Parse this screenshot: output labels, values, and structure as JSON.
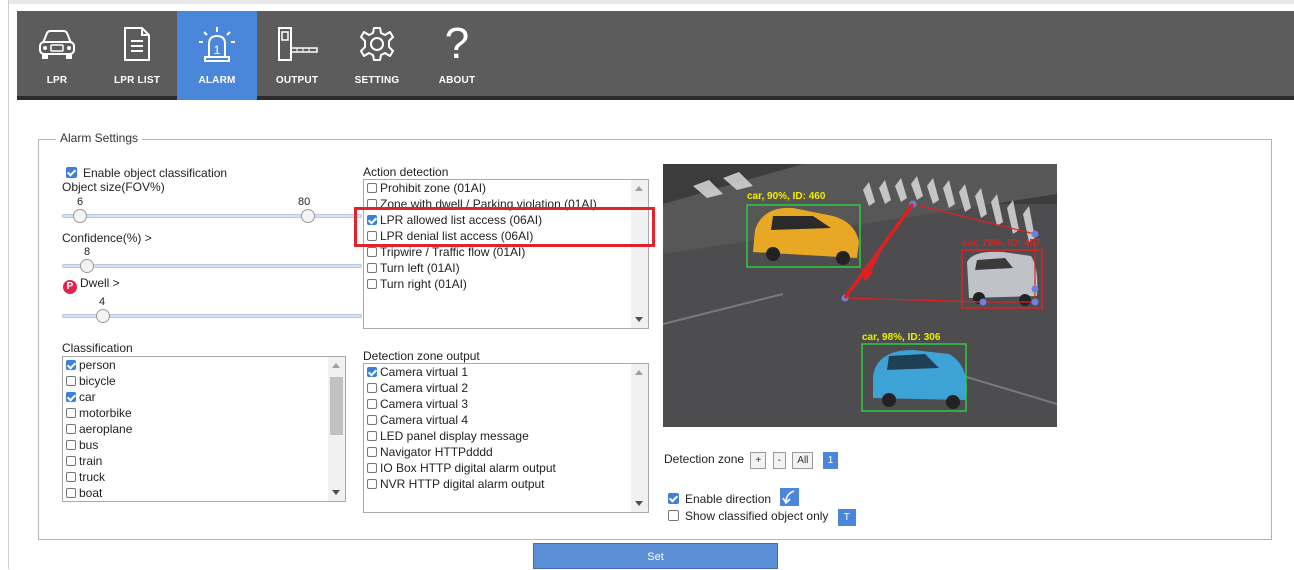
{
  "nav": [
    {
      "label": "LPR",
      "icon": "car-icon",
      "active": false
    },
    {
      "label": "LPR LIST",
      "icon": "document-icon",
      "active": false
    },
    {
      "label": "ALARM",
      "icon": "alarm-siren-icon",
      "active": true
    },
    {
      "label": "OUTPUT",
      "icon": "gate-barrier-icon",
      "active": false
    },
    {
      "label": "SETTING",
      "icon": "gear-icon",
      "active": false
    },
    {
      "label": "ABOUT",
      "icon": "question-icon",
      "active": false
    }
  ],
  "alarm": {
    "legend": "Alarm Settings",
    "enable_classification_label": "Enable object classification",
    "enable_classification_checked": true,
    "object_size_label": "Object size(FOV%)",
    "object_size_min_value": "6",
    "object_size_max_value": "80",
    "confidence_label": "Confidence(%) >",
    "confidence_value": "8",
    "dwell_label": "Dwell >",
    "dwell_value": "4",
    "dwell_icon": "parking-icon",
    "classification_label": "Classification",
    "classification_items": [
      {
        "label": "person",
        "checked": true
      },
      {
        "label": "bicycle",
        "checked": false
      },
      {
        "label": "car",
        "checked": true
      },
      {
        "label": "motorbike",
        "checked": false
      },
      {
        "label": "aeroplane",
        "checked": false
      },
      {
        "label": "bus",
        "checked": false
      },
      {
        "label": "train",
        "checked": false
      },
      {
        "label": "truck",
        "checked": false
      },
      {
        "label": "boat",
        "checked": false
      }
    ],
    "action_detection_label": "Action detection",
    "action_items": [
      {
        "label": "Prohibit zone (01AI)",
        "checked": false
      },
      {
        "label": "Zone with dwell / Parking violation (01AI)",
        "checked": false
      },
      {
        "label": "LPR allowed list access (06AI)",
        "checked": true
      },
      {
        "label": "LPR denial list access (06AI)",
        "checked": false
      },
      {
        "label": "Tripwire / Traffic flow (01AI)",
        "checked": false
      },
      {
        "label": "Turn left (01AI)",
        "checked": false
      },
      {
        "label": "Turn right (01AI)",
        "checked": false
      }
    ],
    "zone_output_label": "Detection zone output",
    "zone_output_items": [
      {
        "label": "Camera virtual 1",
        "checked": true
      },
      {
        "label": "Camera virtual 2",
        "checked": false
      },
      {
        "label": "Camera virtual 3",
        "checked": false
      },
      {
        "label": "Camera virtual 4",
        "checked": false
      },
      {
        "label": "LED panel display message",
        "checked": false
      },
      {
        "label": "Navigator HTTPdddd",
        "checked": false
      },
      {
        "label": "IO Box HTTP digital alarm output",
        "checked": false
      },
      {
        "label": "NVR HTTP digital alarm output",
        "checked": false
      }
    ],
    "detections": [
      {
        "label": "car, 90%, ID: 460"
      },
      {
        "label": "car, 70%, ID: 457"
      },
      {
        "label": "car, 98%, ID: 306"
      }
    ],
    "detection_zone_label": "Detection zone",
    "zone_add": "+",
    "zone_remove": "-",
    "zone_all": "All",
    "zone_number": "1",
    "enable_direction_label": "Enable direction",
    "enable_direction_checked": true,
    "show_classified_label": "Show classified object only",
    "show_classified_checked": false,
    "show_classified_btn": "T",
    "set_label": "Set"
  }
}
